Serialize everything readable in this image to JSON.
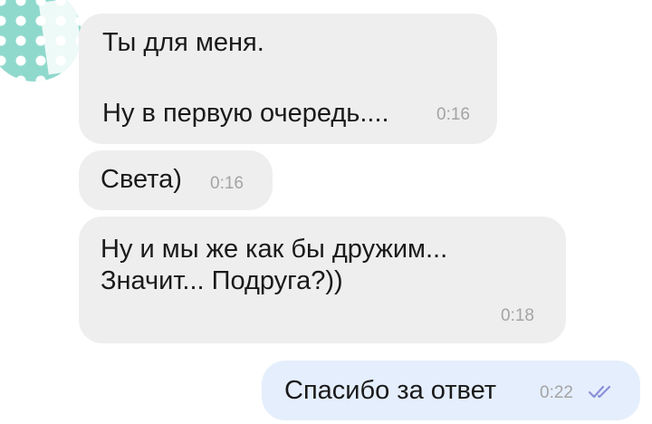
{
  "messages": [
    {
      "lines": [
        "Ты для меня.",
        "",
        "Ну в первую очередь...."
      ],
      "time": "0:16"
    },
    {
      "lines": [
        "Света)"
      ],
      "time": "0:16"
    },
    {
      "lines": [
        "Ну и мы же как бы дружим...",
        "Значит... Подруга?))"
      ],
      "time": "0:18"
    },
    {
      "lines": [
        "Спасибо за ответ"
      ],
      "time": "0:22"
    }
  ],
  "colors": {
    "incoming_bubble": "#eeeeee",
    "outgoing_bubble": "#e5eefc",
    "read_check": "#8a90d8"
  },
  "icons": {
    "avatar": "avatar-icon",
    "read_status": "double-check-icon"
  }
}
